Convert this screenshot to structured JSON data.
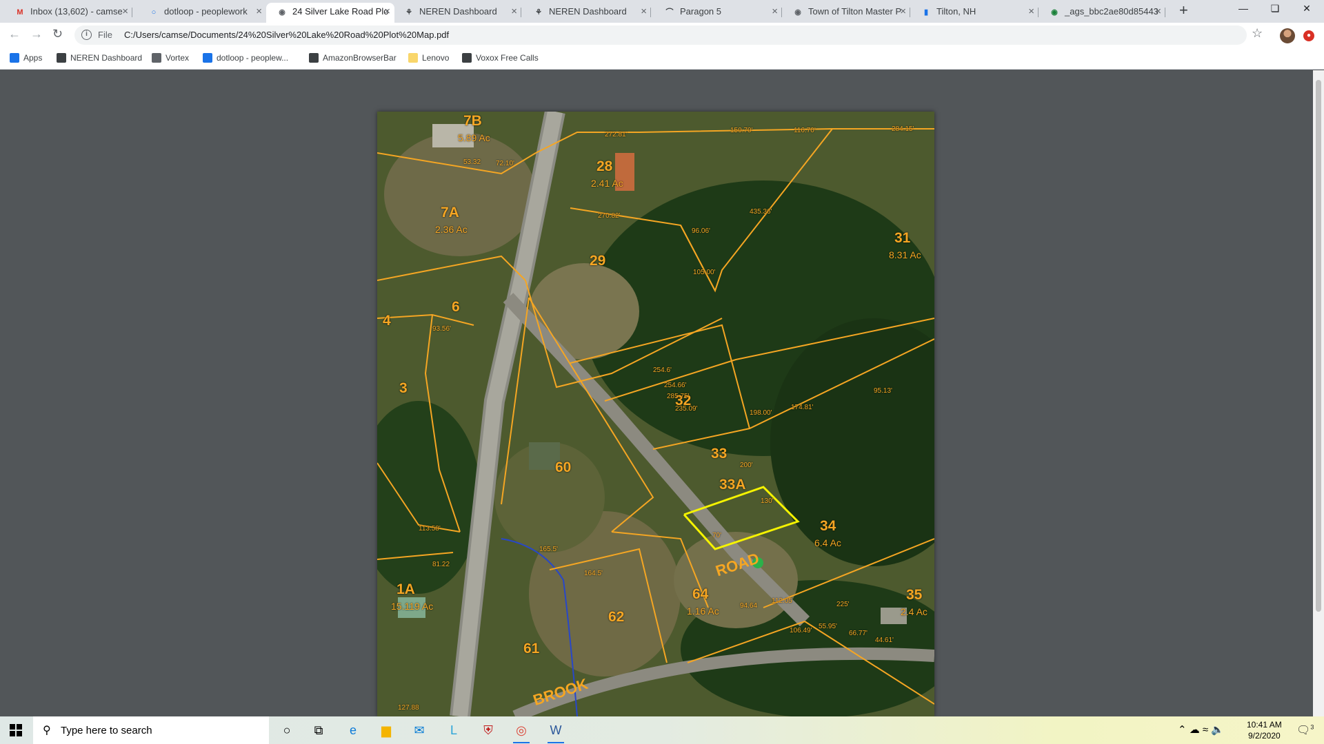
{
  "tabs": [
    {
      "title": "Inbox (13,602) - camse",
      "icon": "gmail-icon",
      "color": "#d93025",
      "glyph": "M"
    },
    {
      "title": "dotloop - peoplework",
      "icon": "dotloop-icon",
      "color": "#1a73e8",
      "glyph": "○"
    },
    {
      "title": "24 Silver Lake Road Plo",
      "icon": "globe-icon",
      "color": "#5f6368",
      "glyph": "◉",
      "active": true
    },
    {
      "title": "NEREN Dashboard",
      "icon": "neren-icon",
      "color": "#3c4043",
      "glyph": "⚘"
    },
    {
      "title": "NEREN Dashboard",
      "icon": "neren-icon",
      "color": "#3c4043",
      "glyph": "⚘"
    },
    {
      "title": "Paragon 5",
      "icon": "paragon-icon",
      "color": "#3c4043",
      "glyph": "⌒"
    },
    {
      "title": "Town of Tilton Master P",
      "icon": "globe-icon",
      "color": "#5f6368",
      "glyph": "◉"
    },
    {
      "title": "Tilton, NH",
      "icon": "document-icon",
      "color": "#1a73e8",
      "glyph": "▮"
    },
    {
      "title": "_ags_bbc2ae80d85443",
      "icon": "globe-icon",
      "color": "#188038",
      "glyph": "◉"
    }
  ],
  "toolbar": {
    "scheme": "File",
    "url": "C:/Users/camse/Documents/24%20Silver%20Lake%20Road%20Plot%20Map.pdf"
  },
  "bookmarks": [
    {
      "label": "Apps",
      "icon": "apps-grid-icon",
      "color": "#1a73e8"
    },
    {
      "label": "NEREN Dashboard",
      "icon": "neren-icon",
      "color": "#3c4043"
    },
    {
      "label": "Vortex",
      "icon": "vortex-icon",
      "color": "#5f6368"
    },
    {
      "label": "dotloop - peoplew...",
      "icon": "dotloop-icon",
      "color": "#1a73e8"
    },
    {
      "label": "AmazonBrowserBar",
      "icon": "globe-icon",
      "color": "#3c4043"
    },
    {
      "label": "Lenovo",
      "icon": "folder-icon",
      "color": "#f9d66b"
    },
    {
      "label": "Voxox Free Calls",
      "icon": "globe-icon",
      "color": "#3c4043"
    }
  ],
  "map": {
    "lots": [
      {
        "id": "7B",
        "acres": "5.89 Ac"
      },
      {
        "id": "28",
        "acres": "2.41 Ac"
      },
      {
        "id": "7A",
        "acres": "2.36 Ac"
      },
      {
        "id": "29",
        "acres": ""
      },
      {
        "id": "31",
        "acres": "8.31 Ac"
      },
      {
        "id": "6",
        "acres": ""
      },
      {
        "id": "4",
        "acres": ""
      },
      {
        "id": "3",
        "acres": ""
      },
      {
        "id": "32",
        "acres": ""
      },
      {
        "id": "33",
        "acres": ""
      },
      {
        "id": "33A",
        "acres": ""
      },
      {
        "id": "60",
        "acres": ""
      },
      {
        "id": "34",
        "acres": "6.4 Ac"
      },
      {
        "id": "35",
        "acres": "2.4 Ac"
      },
      {
        "id": "1A",
        "acres": "15.119 Ac"
      },
      {
        "id": "64",
        "acres": "1.16 Ac"
      },
      {
        "id": "62",
        "acres": ""
      },
      {
        "id": "61",
        "acres": ""
      }
    ],
    "road_labels": [
      "ROAD",
      "BROOK"
    ],
    "dimensions": [
      "272.81'",
      "150.70'",
      "116.70'",
      "284.15'",
      "53.32",
      "72.10'",
      "270.82'",
      "96.06'",
      "105.00'",
      "435.36'",
      "93.56'",
      "254.6'",
      "254.66'",
      "285.75'",
      "235.09'",
      "198.00'",
      "174.81'",
      "95.13'",
      "200'",
      "130'",
      "70'",
      "113.58'",
      "81.22",
      "165.5'",
      "164.5'",
      "112.05",
      "94.64",
      "106.49'",
      "55.95'",
      "66.77'",
      "44.61'",
      "127.88",
      "225'"
    ]
  },
  "taskbar": {
    "search_placeholder": "Type here to search",
    "apps": [
      {
        "name": "cortana-icon",
        "glyph": "○",
        "color": "#000000"
      },
      {
        "name": "task-view-icon",
        "glyph": "⧉",
        "color": "#000000"
      },
      {
        "name": "edge-icon",
        "glyph": "e",
        "color": "#0c7bd8"
      },
      {
        "name": "file-explorer-icon",
        "glyph": "▆",
        "color": "#f4b400"
      },
      {
        "name": "mail-icon",
        "glyph": "✉",
        "color": "#0078d4"
      },
      {
        "name": "l-app-icon",
        "glyph": "L",
        "color": "#2aa4d8"
      },
      {
        "name": "mcafee-icon",
        "glyph": "⛨",
        "color": "#c01818"
      },
      {
        "name": "chrome-icon",
        "glyph": "◎",
        "color": "#db4437"
      },
      {
        "name": "word-icon",
        "glyph": "W",
        "color": "#2b579a"
      }
    ],
    "clock_time": "10:41 AM",
    "clock_date": "9/2/2020",
    "notification_count": "3"
  }
}
